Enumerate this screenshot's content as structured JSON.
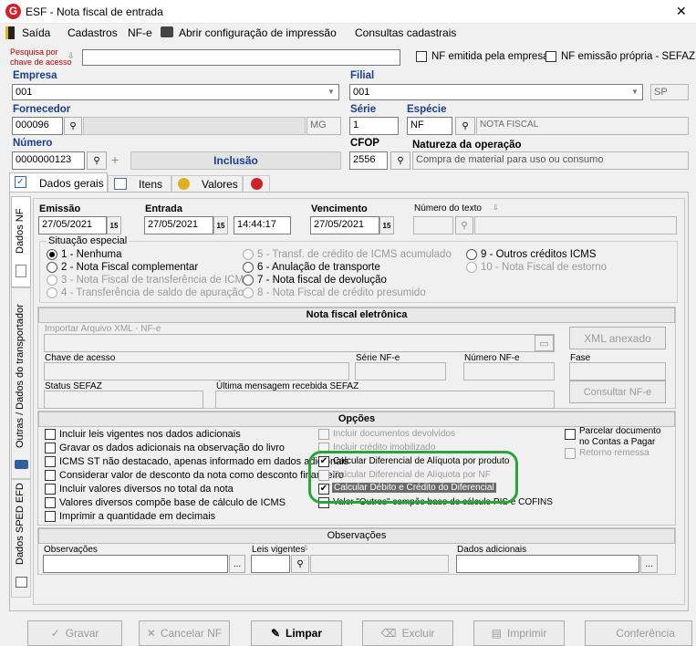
{
  "window": {
    "title": "ESF - Nota fiscal de entrada",
    "close": "✕"
  },
  "menu": {
    "saida": "Saída",
    "cadastros": "Cadastros",
    "nfe": "NF-e",
    "config_impressao": "Abrir configuração de impressão",
    "consultas": "Consultas cadastrais"
  },
  "search": {
    "label1": "Pesquisa por",
    "label2": "chave de acesso",
    "value": ""
  },
  "flags": {
    "nf_emitida": "NF emitida pela empresa",
    "nf_propria": "NF emissão própria - SEFAZ"
  },
  "empresa": {
    "label": "Empresa",
    "value": "001"
  },
  "filial": {
    "label": "Filial",
    "value": "001",
    "uf": "SP"
  },
  "fornecedor": {
    "label": "Fornecedor",
    "code": "000096",
    "uf": "MG"
  },
  "serie": {
    "label": "Série",
    "value": "1"
  },
  "especie": {
    "label": "Espécie",
    "value": "NF",
    "desc": "NOTA FISCAL"
  },
  "numero": {
    "label": "Número",
    "value": "0000000123",
    "status": "Inclusão"
  },
  "cfop": {
    "label": "CFOP",
    "value": "2556"
  },
  "natureza": {
    "label": "Natureza da operação",
    "value": "Compra de material para uso ou consumo"
  },
  "tabs": {
    "dados_gerais": "Dados gerais",
    "itens": "Itens",
    "valores": "Valores"
  },
  "side_tabs": {
    "dados_nf": "Dados NF",
    "transportador": "Outras / Dados do transportador",
    "sped": "Dados SPED EFD"
  },
  "dates": {
    "emissao_label": "Emissão",
    "emissao": "27/05/2021",
    "entrada_label": "Entrada",
    "entrada": "27/05/2021",
    "hora": "14:44:17",
    "vencimento_label": "Vencimento",
    "vencimento": "27/05/2021",
    "numero_texto_label": "Número do texto",
    "cal": "15"
  },
  "situacao": {
    "title": "Situação especial",
    "col1": [
      "1 - Nenhuma",
      "2 - Nota Fiscal complementar",
      "3 - Nota Fiscal de transferência de ICMS",
      "4 - Transferência de saldo de apuração"
    ],
    "col2": [
      "5 - Transf. de crédito de ICMS acumulado",
      "6 - Anulação de transporte",
      "7 - Nota fiscal de devolução",
      "8 - Nota Fiscal de crédito presumido"
    ],
    "col3": [
      "9 - Outros créditos ICMS",
      "10 - Nota Fiscal de estorno"
    ]
  },
  "nfe": {
    "title": "Nota fiscal eletrônica",
    "importar": "Importar Arquivo XML - NF-e",
    "xml_anexado": "XML anexado",
    "chave": "Chave de acesso",
    "serie": "Série NF-e",
    "numero": "Número NF-e",
    "fase": "Fase",
    "status": "Status SEFAZ",
    "ultima_msg": "Última mensagem recebida SEFAZ",
    "consultar": "Consultar NF-e"
  },
  "opcoes": {
    "title": "Opções",
    "col1": [
      "Incluir leis vigentes nos dados adicionais",
      "Gravar os dados adicionais na observação do livro",
      "ICMS ST não destacado, apenas informado em dados adicionais",
      "Considerar valor de desconto da nota como desconto financeiro",
      "Incluir valores diversos no total da nota",
      "Valores diversos compõe base de cálculo de ICMS",
      "Imprimir a quantidade em decimais"
    ],
    "col2": [
      "Incluir documentos devolvidos",
      "Incluir crédito imobilizado",
      "Calcular Diferencial de Alíquota por produto",
      "Calcular Diferencial de Alíquota por NF",
      "Calcular Débito e Crédito do Diferencial",
      "Valor \"Outros\" compõe base de cálculo PIS e COFINS"
    ],
    "col3_line1": "Parcelar documento",
    "col3_line2": "no Contas a Pagar",
    "retorno": "Retorno remessa"
  },
  "obs": {
    "title": "Observações",
    "observacoes": "Observações",
    "leis": "Leis vigentes",
    "dados_adicionais": "Dados adicionais",
    "ellipsis": "..."
  },
  "footer": {
    "gravar": "Gravar",
    "cancelar": "Cancelar NF",
    "limpar": "Limpar",
    "excluir": "Excluir",
    "imprimir": "Imprimir",
    "conferencia": "Conferência"
  },
  "colors": {
    "highlight": "#2aa53a",
    "selected": "#6b6b6b",
    "logo": "#d0202a"
  }
}
